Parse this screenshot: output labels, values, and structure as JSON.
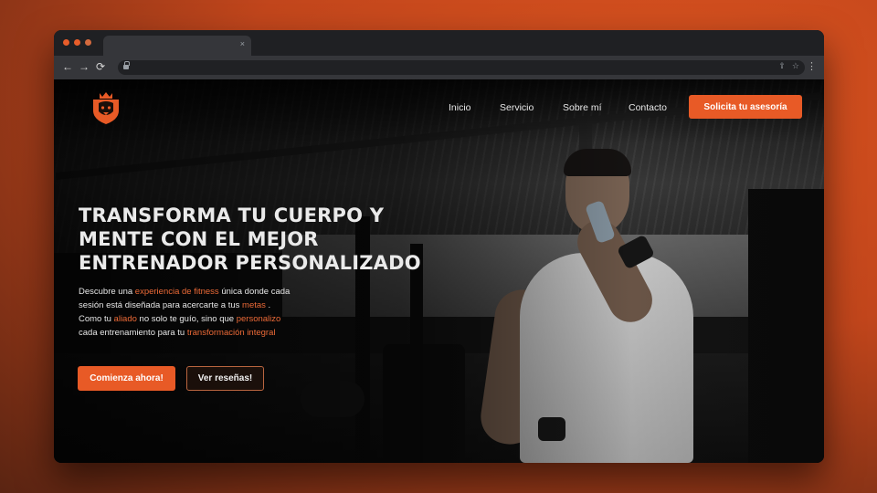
{
  "browser": {
    "tab_close": "×",
    "nav_back": "←",
    "nav_forward": "→",
    "nav_reload": "⟳",
    "share_icon": "⇪",
    "star_icon": "☆",
    "menu_icon": "⋮"
  },
  "nav": {
    "items": [
      "Inicio",
      "Servicio",
      "Sobre mí",
      "Contacto"
    ],
    "cta": "Solicita tu asesoría"
  },
  "hero": {
    "title": "TRANSFORMA TU CUERPO Y MENTE CON EL MEJOR ENTRENADOR PERSONALIZADO",
    "text_parts": [
      {
        "text": "Descubre una ",
        "highlight": false
      },
      {
        "text": "experiencia de fitness",
        "highlight": true
      },
      {
        "text": " única donde cada sesión está diseñada para acercarte a tus ",
        "highlight": false
      },
      {
        "text": "metas",
        "highlight": true
      },
      {
        "text": " . Como tu ",
        "highlight": false
      },
      {
        "text": "aliado",
        "highlight": true
      },
      {
        "text": " no solo te guío, sino que ",
        "highlight": false
      },
      {
        "text": "personalizo",
        "highlight": true
      },
      {
        "text": " cada entrenamiento para tu ",
        "highlight": false
      },
      {
        "text": "transformación integral",
        "highlight": true
      }
    ],
    "primary_button": "Comienza ahora!",
    "secondary_button": "Ver reseñas!"
  },
  "colors": {
    "accent": "#e85a26",
    "highlight": "#ec6a37",
    "background_outer": "#c2461c"
  },
  "icons": {
    "logo": "lion-shield-logo"
  }
}
